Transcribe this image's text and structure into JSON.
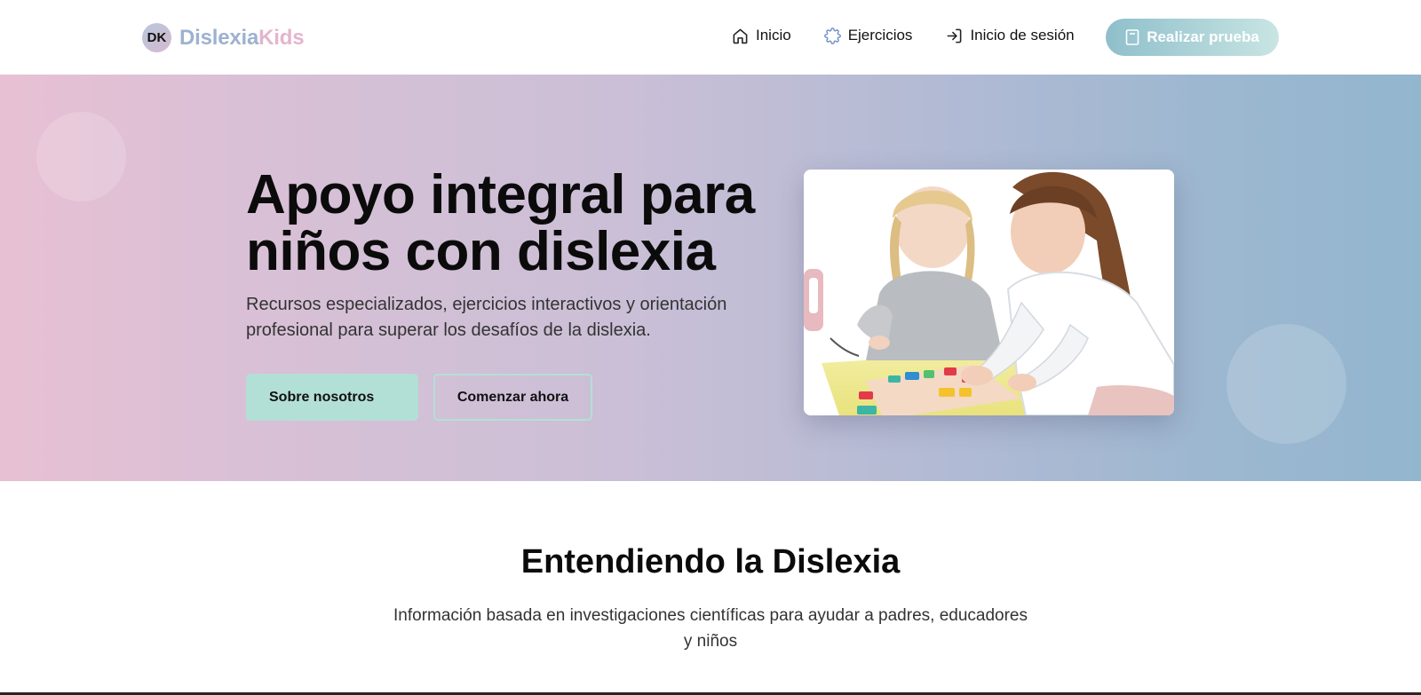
{
  "brand": {
    "initials": "DK",
    "name_part1": "Dislexia",
    "name_part2": "Kids"
  },
  "nav": {
    "items": [
      {
        "label": "Inicio",
        "icon": "home-icon"
      },
      {
        "label": "Ejercicios",
        "icon": "puzzle-icon"
      },
      {
        "label": "Inicio de sesión",
        "icon": "login-icon"
      }
    ],
    "cta_label": "Realizar prueba",
    "cta_icon": "document-icon"
  },
  "hero": {
    "title": "Apoyo integral para niños con dislexia",
    "subtitle": "Recursos especializados, ejercicios interactivos y orientación profesional para superar los desafíos de la dislexia.",
    "primary_button": "Sobre nosotros",
    "secondary_button": "Comenzar ahora"
  },
  "section": {
    "title": "Entendiendo la Dislexia",
    "description": "Información basada en investigaciones científicas para ayudar a padres, educadores y niños"
  },
  "colors": {
    "accent_mint": "#b3e0d6",
    "logo_blue": "#9db2cf",
    "logo_pink": "#e4b5cd",
    "hero_gradient_start": "#e8c0d3",
    "hero_gradient_end": "#93b6cf"
  }
}
